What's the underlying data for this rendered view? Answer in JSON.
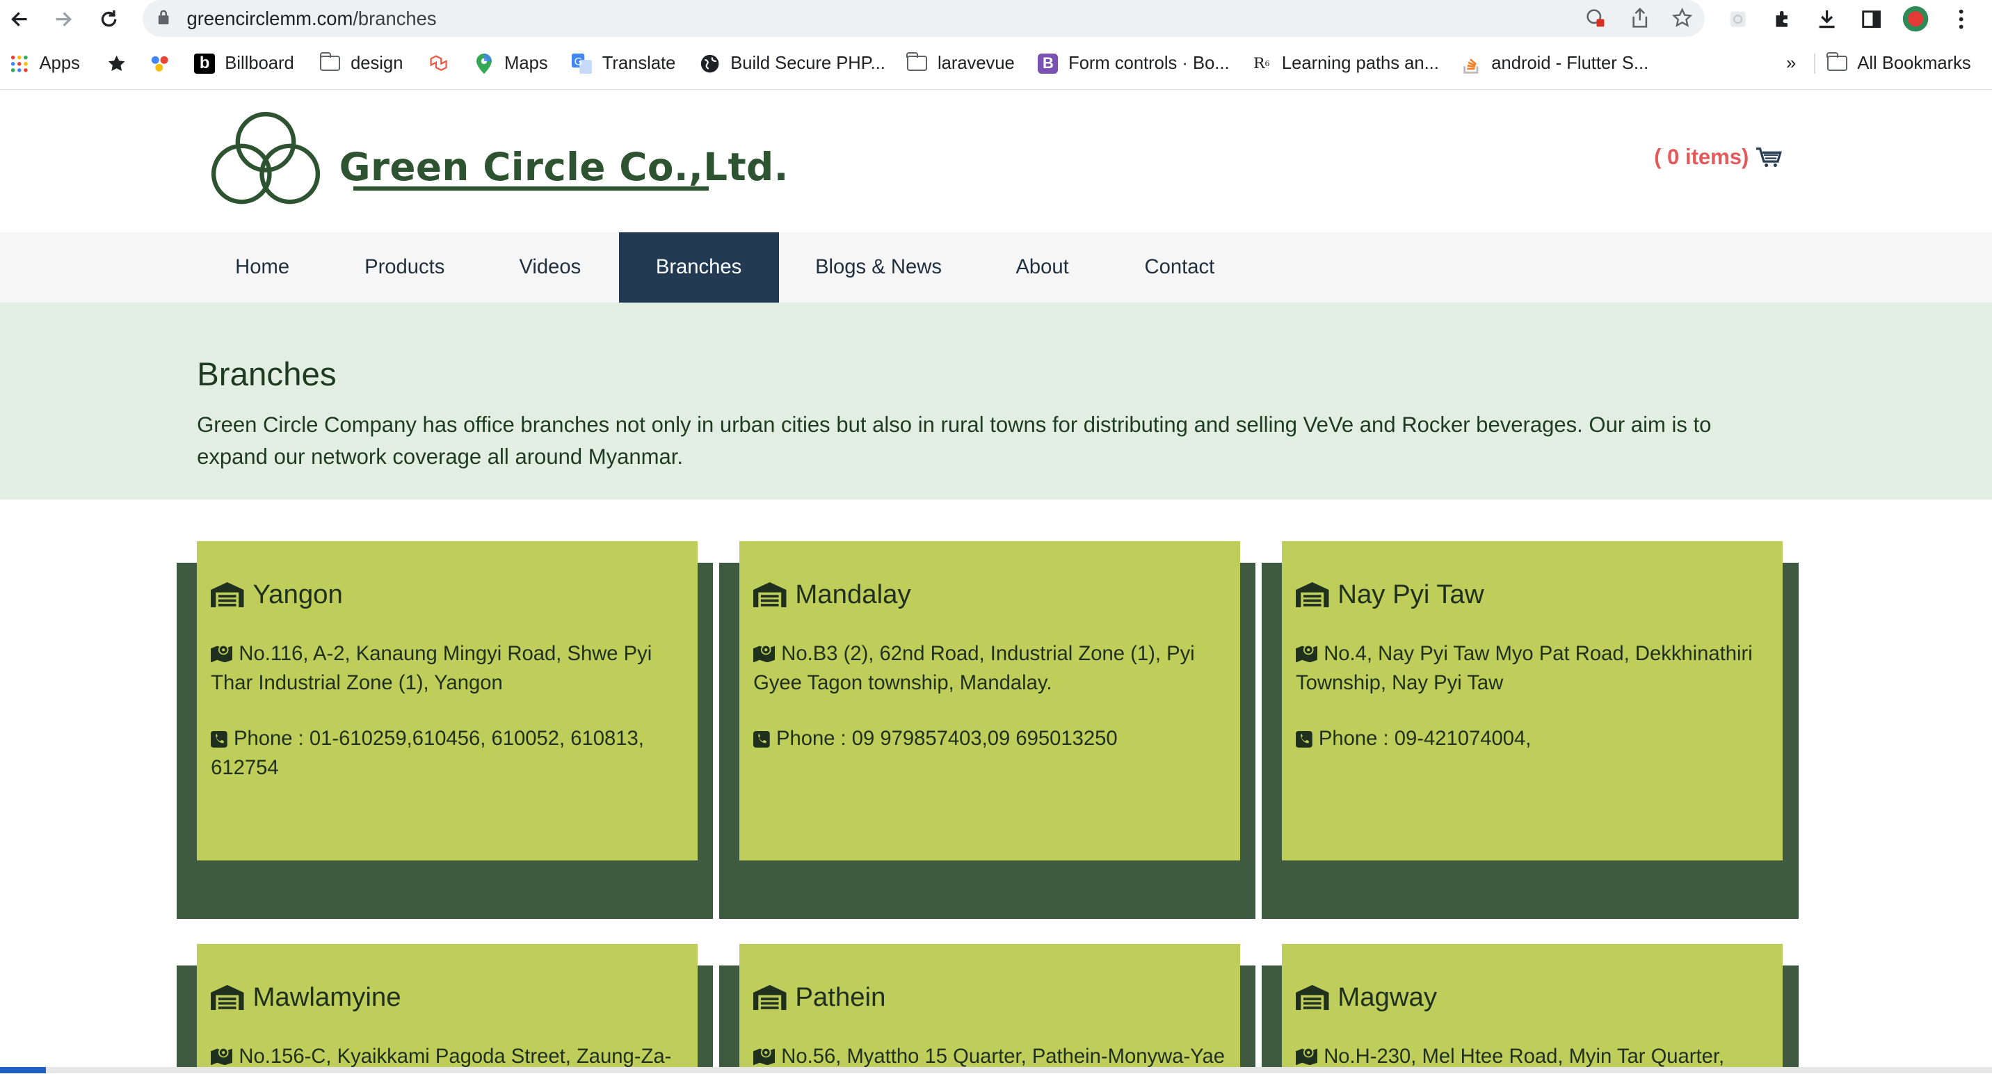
{
  "browser": {
    "url_host": "greencirclemm.com",
    "url_path": "/branches",
    "bookmarks": [
      {
        "label": "Apps",
        "icon": "apps-grid-icon"
      },
      {
        "label": "",
        "icon": "star-icon"
      },
      {
        "label": "",
        "icon": "colorful-logo-icon"
      },
      {
        "label": "Billboard",
        "icon": "billboard-b-icon"
      },
      {
        "label": "design",
        "icon": "folder-icon"
      },
      {
        "label": "",
        "icon": "laravel-icon"
      },
      {
        "label": "Maps",
        "icon": "maps-pin-icon"
      },
      {
        "label": "Translate",
        "icon": "translate-icon"
      },
      {
        "label": "Build Secure PHP...",
        "icon": "globe-icon"
      },
      {
        "label": "laravevue",
        "icon": "folder-icon"
      },
      {
        "label": "Form controls · Bo...",
        "icon": "bootstrap-icon"
      },
      {
        "label": "Learning paths an...",
        "icon": "r-icon"
      },
      {
        "label": "android - Flutter S...",
        "icon": "stackoverflow-icon"
      }
    ],
    "more_label": "»",
    "all_bookmarks_label": "All Bookmarks"
  },
  "site": {
    "company_name": "Green Circle Co.,Ltd.",
    "cart_label": "( 0 items)",
    "nav": [
      "Home",
      "Products",
      "Videos",
      "Branches",
      "Blogs & News",
      "About",
      "Contact"
    ],
    "active_nav": "Branches",
    "page_title": "Branches",
    "intro": "Green Circle Company has office branches not only in urban cities but also in rural towns for distributing and selling VeVe and Rocker beverages. Our aim is to expand our network coverage all around Myanmar.",
    "branches": [
      {
        "name": "Yangon",
        "address": "No.116, A-2, Kanaung Mingyi Road, Shwe Pyi Thar Industrial Zone (1), Yangon",
        "phone": "Phone : 01-610259,610456, 610052, 610813, 612754"
      },
      {
        "name": "Mandalay",
        "address": "No.B3 (2), 62nd Road, Industrial Zone (1), Pyi Gyee Tagon township, Mandalay.",
        "phone": "Phone : 09 979857403,09 695013250"
      },
      {
        "name": "Nay Pyi Taw",
        "address": "No.4, Nay Pyi Taw Myo Pat Road, Dekkhinathiri Township, Nay Pyi Taw",
        "phone": "Phone : 09-421074004,"
      },
      {
        "name": "Mawlamyine",
        "address": "No.156-C, Kyaikkami Pagoda Street, Zaung-Za-",
        "phone": ""
      },
      {
        "name": "Pathein",
        "address": "No.56, Myattho 15 Quarter, Pathein-Monywa-Yae",
        "phone": ""
      },
      {
        "name": "Magway",
        "address": "No.H-230, Mel Htee Road, Myin Tar Quarter,",
        "phone": ""
      }
    ],
    "colors": {
      "brand_green": "#2e5330",
      "card_lime": "#bfce5a",
      "card_shadow": "#3e5a40",
      "nav_active": "#223a52",
      "cart_red": "#e25a5a"
    }
  }
}
